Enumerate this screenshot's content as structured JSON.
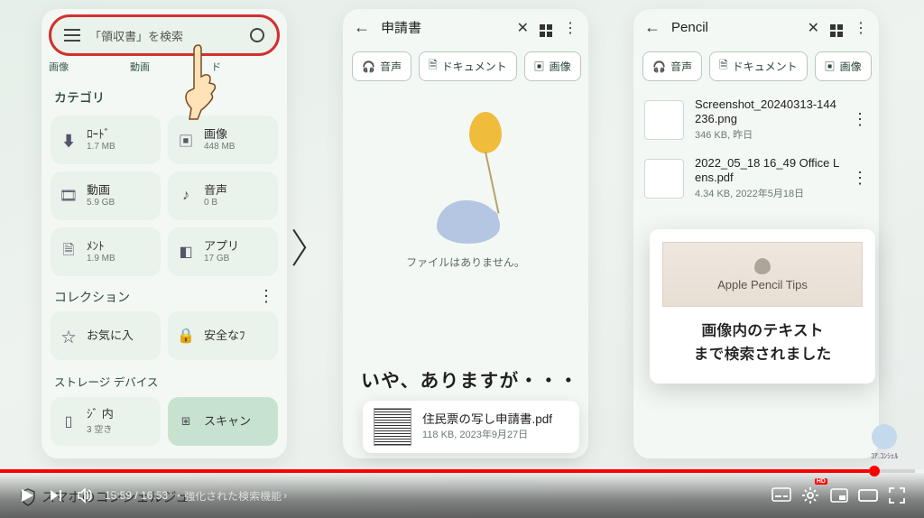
{
  "phone1": {
    "search_placeholder": "「領収書」を検索",
    "tabs": {
      "image": "画像",
      "video": "動画",
      "doc": "ド"
    },
    "section_category": "カテゴリ",
    "tiles": [
      {
        "icon": "download",
        "label": "ﾛｰﾄﾞ",
        "size": "1.7 MB"
      },
      {
        "icon": "image",
        "label": "画像",
        "size": "448 MB"
      },
      {
        "icon": "video",
        "label": "動画",
        "size": "5.9 GB"
      },
      {
        "icon": "music",
        "label": "音声",
        "size": "0 B"
      },
      {
        "icon": "doc",
        "label": "ﾒﾝﾄ",
        "size": "1.9 MB"
      },
      {
        "icon": "apps",
        "label": "アプリ",
        "size": "17 GB"
      }
    ],
    "section_collection": "コレクション",
    "fav": "お気に入",
    "safe": "安全なﾌ",
    "section_storage": "ストレージ デバイス",
    "internal_line1": "ｼﾞ 内",
    "internal_line2": "3   空き",
    "scan": "スキャン"
  },
  "phone2": {
    "query": "申請書",
    "chips": {
      "audio": "音声",
      "doc": "ドキュメント",
      "image": "画像"
    },
    "empty_msg": "ファイルはありません。",
    "caption": "いや、ありますが・・・",
    "file_name": "住民票の写し申請書.pdf",
    "file_meta": "118 KB, 2023年9月27日"
  },
  "phone3": {
    "query": "Pencil",
    "chips": {
      "audio": "音声",
      "doc": "ドキュメント",
      "image": "画像"
    },
    "files": [
      {
        "name": "Screenshot_20240313-144236.png",
        "meta": "346 KB, 昨日"
      },
      {
        "name": "2022_05_18 16_49 Office Lens.pdf",
        "meta": "4.34 KB, 2022年5月18日"
      }
    ],
    "preview_caption": "Apple Pencil Tips",
    "annotation_line1": "画像内のテキスト",
    "annotation_line2": "まで検索されました"
  },
  "watermark": "スマホのコンシェルジュ",
  "desktop_icon": "ｺｱ.ｺﾝｼｪﾙ",
  "player": {
    "time_current": "15:59",
    "time_total": "16:53",
    "chapter": "・強化された検索機能",
    "hd": "HD"
  }
}
